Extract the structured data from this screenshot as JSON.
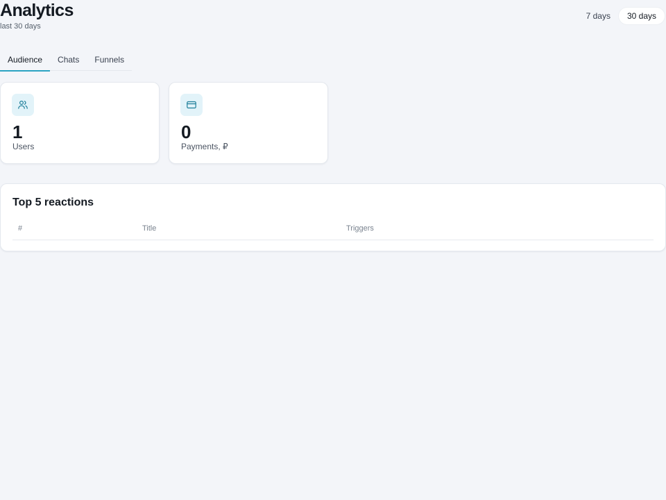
{
  "header": {
    "title": "Analytics",
    "subtitle": "last 30 days",
    "range_options": [
      {
        "label": "7 days",
        "active": false
      },
      {
        "label": "30 days",
        "active": true
      }
    ]
  },
  "tabs": [
    {
      "label": "Audience",
      "active": true
    },
    {
      "label": "Chats",
      "active": false
    },
    {
      "label": "Funnels",
      "active": false
    }
  ],
  "stats": [
    {
      "icon": "users-icon",
      "value": "1",
      "label": "Users"
    },
    {
      "icon": "credit-card-icon",
      "value": "0",
      "label": "Payments, ₽"
    }
  ],
  "reactions": {
    "title": "Top 5 reactions",
    "columns": [
      "#",
      "Title",
      "Triggers"
    ],
    "rows": []
  },
  "colors": {
    "accent": "#2aa3c2",
    "icon_bg": "#e2f3f9",
    "page_bg": "#f3f5f9"
  }
}
